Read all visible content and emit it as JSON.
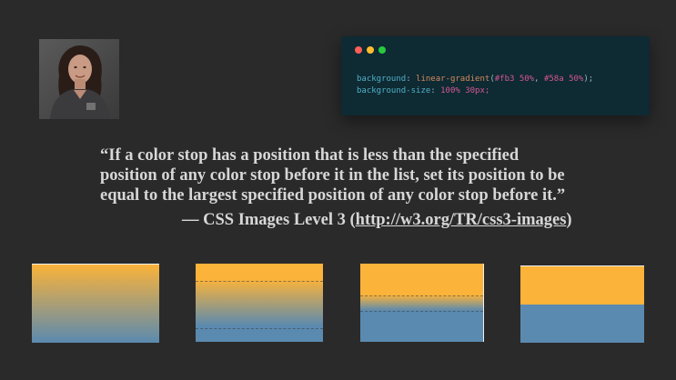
{
  "code": {
    "line1": {
      "prop": "background",
      "fn": "linear-gradient",
      "color1": "#fb3",
      "stop1": "50%",
      "color2": "#58a",
      "stop2": "50%"
    },
    "line2": {
      "prop": "background-size",
      "value": "100% 30px;"
    },
    "dots": {
      "close": "#ff5f56",
      "minimize": "#ffbd2e",
      "maximize": "#27c93f"
    }
  },
  "quote": {
    "line1": "“If a color stop has a position that is less than the specified",
    "line2": "position of any color stop before it in the list, set its position to be",
    "line3": "equal to the largest specified position of any color stop before it.”"
  },
  "attribution": {
    "prefix": "— CSS Images Level 3 (",
    "link": "http://w3.org/TR/css3-images",
    "suffix": ")"
  },
  "colors": {
    "yellow": "#fbb33a",
    "blue": "#5a8ab0",
    "background": "#2a2a2a",
    "code_bg": "#0e2a33"
  },
  "gradient_boxes": [
    {
      "name": "gradient-box-smooth"
    },
    {
      "name": "gradient-box-narrower"
    },
    {
      "name": "gradient-box-narrowest"
    },
    {
      "name": "gradient-box-hard-stop"
    }
  ]
}
